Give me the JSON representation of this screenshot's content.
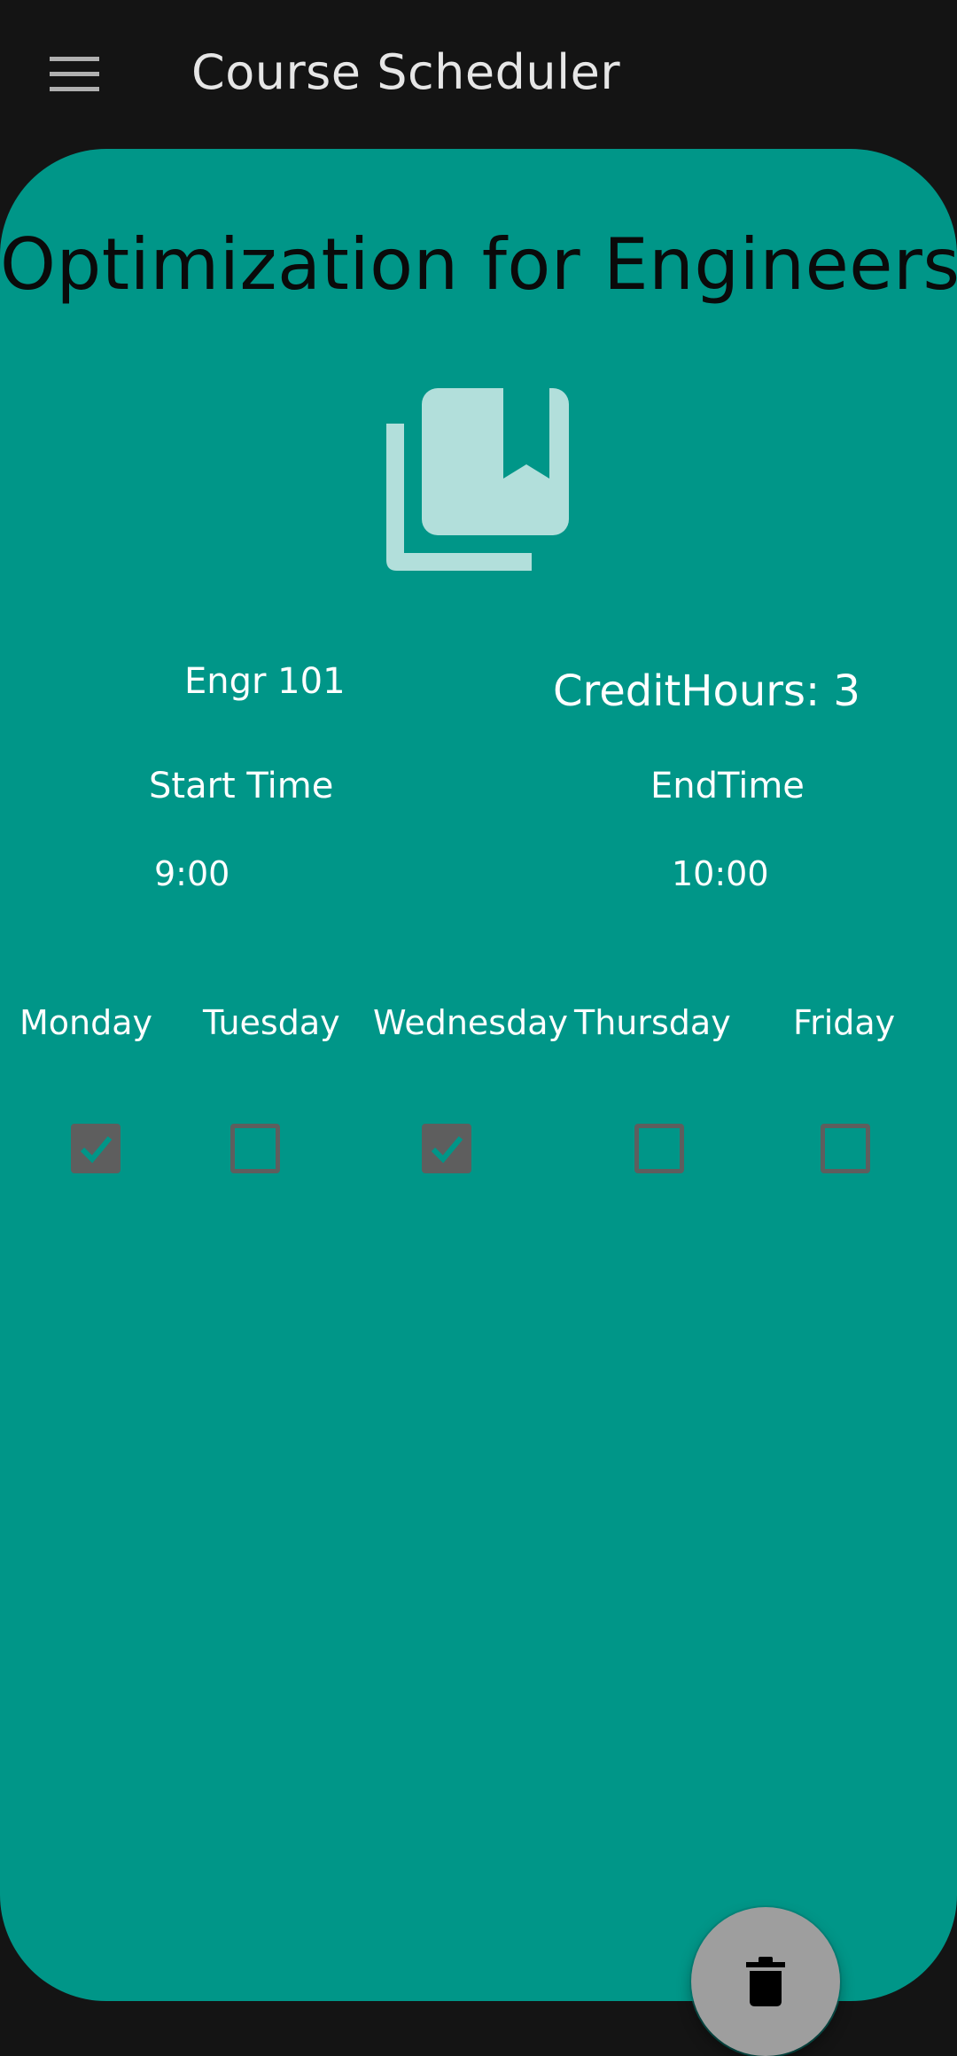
{
  "appbar": {
    "title": "Course Scheduler"
  },
  "course": {
    "title": "Optimization for Engineers",
    "code": "Engr 101",
    "credit_label": "CreditHours:  3",
    "start_label": "Start Time",
    "end_label": "EndTime",
    "start_time": "9:00",
    "end_time": "10:00"
  },
  "days": [
    {
      "label": "Monday",
      "checked": true
    },
    {
      "label": "Tuesday",
      "checked": false
    },
    {
      "label": "Wednesday",
      "checked": true
    },
    {
      "label": "Thursday",
      "checked": false
    },
    {
      "label": "Friday",
      "checked": false
    }
  ],
  "icons": {
    "menu": "hamburger-menu-icon",
    "course": "library-books-bookmark-icon",
    "delete": "trash-icon"
  },
  "colors": {
    "appbar": "#141414",
    "card": "#009688",
    "checkbox": "#5e5e5e",
    "fab": "#9e9e9e",
    "icon_tint": "#b2dfdb"
  }
}
